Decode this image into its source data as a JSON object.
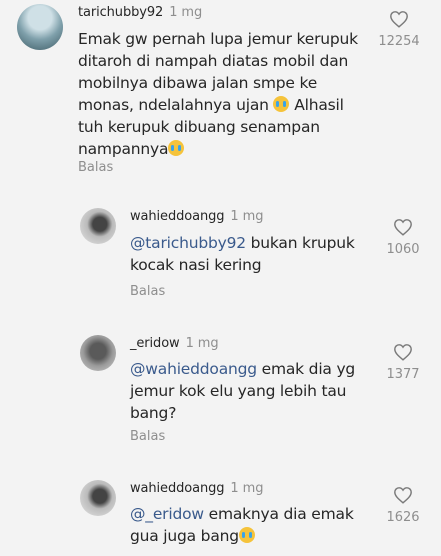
{
  "comments": [
    {
      "username": "tarichubby92",
      "time": "1 mg",
      "text": "Emak gw pernah lupa jemur kerupuk ditaroh di nampah diatas mobil dan mobilnya dibawa jalan smpe ke monas, ndelalahnya ujan",
      "text_after_emoji": "Alhasil tuh kerupuk dibuang senampan nampannya",
      "reply_label": "Balas",
      "likes": "12254"
    },
    {
      "username": "wahieddoangg",
      "time": "1 mg",
      "mention": "@tarichubby92",
      "text": "bukan krupuk kocak nasi kering",
      "reply_label": "Balas",
      "likes": "1060"
    },
    {
      "username": "_eridow",
      "time": "1 mg",
      "mention": "@wahieddoangg",
      "text": "emak dia yg jemur kok elu yang lebih tau bang?",
      "reply_label": "Balas",
      "likes": "1377"
    },
    {
      "username": "wahieddoangg",
      "time": "1 mg",
      "mention": "@_eridow",
      "text": "emaknya dia emak gua juga bang",
      "likes": "1626"
    }
  ],
  "icons": {
    "like": "heart-outline-icon",
    "emoji": "crying-laughing-emoji"
  },
  "colors": {
    "mention": "#3a5a8c",
    "muted": "#8e8e8e",
    "text": "#262626",
    "background": "#f3f3f3"
  }
}
